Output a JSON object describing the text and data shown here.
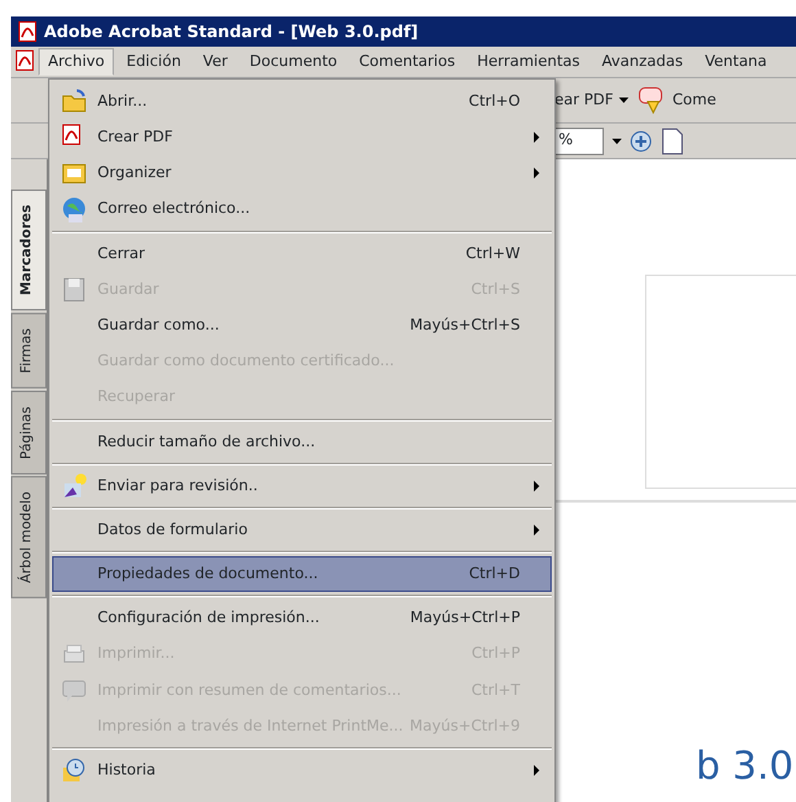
{
  "window": {
    "title": "Adobe Acrobat Standard - [Web 3.0.pdf]"
  },
  "menubar": [
    {
      "label": "Archivo",
      "selected": true
    },
    {
      "label": "Edición",
      "selected": false
    },
    {
      "label": "Ver",
      "selected": false
    },
    {
      "label": "Documento",
      "selected": false
    },
    {
      "label": "Comentarios",
      "selected": false
    },
    {
      "label": "Herramientas",
      "selected": false
    },
    {
      "label": "Avanzadas",
      "selected": false
    },
    {
      "label": "Ventana",
      "selected": false
    }
  ],
  "toolbar": {
    "create_pdf_button": "ear PDF",
    "comment_button": "Come",
    "zoom_field": "%"
  },
  "side_tabs": [
    {
      "label": "Marcadores",
      "selected": true
    },
    {
      "label": "Firmas",
      "selected": false
    },
    {
      "label": "Páginas",
      "selected": false
    },
    {
      "label": "Árbol modelo",
      "selected": false
    }
  ],
  "file_menu": [
    {
      "kind": "item",
      "label": "Abrir...",
      "shortcut": "Ctrl+O",
      "disabled": false,
      "selected": false,
      "submenu": false
    },
    {
      "kind": "item",
      "label": "Crear PDF",
      "disabled": false,
      "selected": false,
      "submenu": true
    },
    {
      "kind": "item",
      "label": "Organizer",
      "disabled": false,
      "selected": false,
      "submenu": true
    },
    {
      "kind": "item",
      "label": "Correo electrónico...",
      "disabled": false,
      "selected": false,
      "submenu": false
    },
    {
      "kind": "separator"
    },
    {
      "kind": "item",
      "label": "Cerrar",
      "shortcut": "Ctrl+W",
      "disabled": false,
      "selected": false,
      "submenu": false
    },
    {
      "kind": "item",
      "label": "Guardar",
      "shortcut": "Ctrl+S",
      "disabled": true,
      "selected": false,
      "submenu": false
    },
    {
      "kind": "item",
      "label": "Guardar como...",
      "shortcut": "Mayús+Ctrl+S",
      "disabled": false,
      "selected": false,
      "submenu": false
    },
    {
      "kind": "item",
      "label": "Guardar como documento certificado...",
      "disabled": true,
      "selected": false,
      "submenu": false
    },
    {
      "kind": "item",
      "label": "Recuperar",
      "disabled": true,
      "selected": false,
      "submenu": false
    },
    {
      "kind": "separator"
    },
    {
      "kind": "item",
      "label": "Reducir tamaño de archivo...",
      "disabled": false,
      "selected": false,
      "submenu": false
    },
    {
      "kind": "separator"
    },
    {
      "kind": "item",
      "label": "Enviar para revisión..",
      "disabled": false,
      "selected": false,
      "submenu": true
    },
    {
      "kind": "separator"
    },
    {
      "kind": "item",
      "label": "Datos de formulario",
      "disabled": false,
      "selected": false,
      "submenu": true
    },
    {
      "kind": "separator"
    },
    {
      "kind": "item",
      "label": "Propiedades de documento...",
      "shortcut": "Ctrl+D",
      "disabled": false,
      "selected": true,
      "submenu": false
    },
    {
      "kind": "separator"
    },
    {
      "kind": "item",
      "label": "Configuración de impresión...",
      "shortcut": "Mayús+Ctrl+P",
      "disabled": false,
      "selected": false,
      "submenu": false
    },
    {
      "kind": "item",
      "label": "Imprimir...",
      "shortcut": "Ctrl+P",
      "disabled": true,
      "selected": false,
      "submenu": false
    },
    {
      "kind": "item",
      "label": "Imprimir con resumen de comentarios...",
      "shortcut": "Ctrl+T",
      "disabled": true,
      "selected": false,
      "submenu": false
    },
    {
      "kind": "item",
      "label": "Impresión a través de Internet PrintMe...",
      "shortcut": "Mayús+Ctrl+9",
      "disabled": true,
      "selected": false,
      "submenu": false
    },
    {
      "kind": "separator"
    },
    {
      "kind": "item",
      "label": "Historia",
      "disabled": false,
      "selected": false,
      "submenu": true
    }
  ],
  "document": {
    "heading_fragment": "b 3.0"
  }
}
